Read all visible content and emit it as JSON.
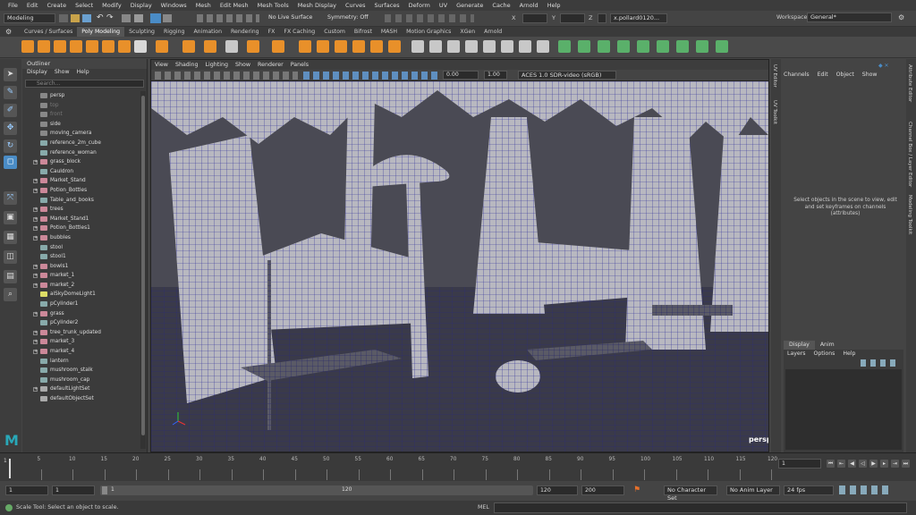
{
  "menus": [
    "File",
    "Edit",
    "Create",
    "Select",
    "Modify",
    "Display",
    "Windows",
    "Mesh",
    "Edit Mesh",
    "Mesh Tools",
    "Mesh Display",
    "Curves",
    "Surfaces",
    "Deform",
    "UV",
    "Generate",
    "Cache",
    "Arnold",
    "Help"
  ],
  "workspace": {
    "label": "Workspace:",
    "value": "General*"
  },
  "status": {
    "mode": "Modeling",
    "live_surface": "No Live Surface",
    "symmetry": "Symmetry: Off",
    "x_label": "X",
    "y_label": "Y",
    "z_label": "Z",
    "user": "x.pollard0120..."
  },
  "shelf_tabs": [
    "Curves / Surfaces",
    "Poly Modeling",
    "Sculpting",
    "Rigging",
    "Animation",
    "Rendering",
    "FX",
    "FX Caching",
    "Custom",
    "Bifrost",
    "MASH",
    "Motion Graphics",
    "XGen",
    "Arnold"
  ],
  "shelf_active": "Poly Modeling",
  "outliner": {
    "title": "Outliner",
    "menu": [
      "Display",
      "Show",
      "Help"
    ],
    "search_placeholder": "Search...",
    "items": [
      {
        "label": "persp",
        "type": "cam",
        "dim": false,
        "exp": false
      },
      {
        "label": "top",
        "type": "cam",
        "dim": true,
        "exp": false
      },
      {
        "label": "front",
        "type": "cam",
        "dim": true,
        "exp": false
      },
      {
        "label": "side",
        "type": "cam",
        "dim": false,
        "exp": false
      },
      {
        "label": "moving_camera",
        "type": "cam",
        "dim": false,
        "exp": false
      },
      {
        "label": "reference_2m_cube",
        "type": "mesh",
        "dim": false,
        "exp": false
      },
      {
        "label": "reference_woman",
        "type": "mesh",
        "dim": false,
        "exp": false
      },
      {
        "label": "grass_block",
        "type": "group",
        "dim": false,
        "exp": true
      },
      {
        "label": "Cauldron",
        "type": "mesh",
        "dim": false,
        "exp": false
      },
      {
        "label": "Market_Stand",
        "type": "group",
        "dim": false,
        "exp": true
      },
      {
        "label": "Potion_Bottles",
        "type": "group",
        "dim": false,
        "exp": true
      },
      {
        "label": "Table_and_books",
        "type": "mesh",
        "dim": false,
        "exp": false
      },
      {
        "label": "trees",
        "type": "group",
        "dim": false,
        "exp": true
      },
      {
        "label": "Market_Stand1",
        "type": "group",
        "dim": false,
        "exp": true
      },
      {
        "label": "Potion_Bottles1",
        "type": "group",
        "dim": false,
        "exp": true
      },
      {
        "label": "bubbles",
        "type": "group",
        "dim": false,
        "exp": true
      },
      {
        "label": "stool",
        "type": "mesh",
        "dim": false,
        "exp": false
      },
      {
        "label": "stool1",
        "type": "mesh",
        "dim": false,
        "exp": false
      },
      {
        "label": "bowls1",
        "type": "group",
        "dim": false,
        "exp": true
      },
      {
        "label": "market_1",
        "type": "group",
        "dim": false,
        "exp": true
      },
      {
        "label": "market_2",
        "type": "group",
        "dim": false,
        "exp": true
      },
      {
        "label": "aiSkyDomeLight1",
        "type": "light",
        "dim": false,
        "exp": false
      },
      {
        "label": "pCylinder1",
        "type": "mesh",
        "dim": false,
        "exp": false
      },
      {
        "label": "grass",
        "type": "group",
        "dim": false,
        "exp": true
      },
      {
        "label": "pCylinder2",
        "type": "mesh",
        "dim": false,
        "exp": false
      },
      {
        "label": "tree_trunk_updated",
        "type": "group",
        "dim": false,
        "exp": true
      },
      {
        "label": "market_3",
        "type": "group",
        "dim": false,
        "exp": true
      },
      {
        "label": "market_4",
        "type": "group",
        "dim": false,
        "exp": true
      },
      {
        "label": "lantern",
        "type": "mesh",
        "dim": false,
        "exp": false
      },
      {
        "label": "mushroom_stalk",
        "type": "mesh",
        "dim": false,
        "exp": false
      },
      {
        "label": "mushroom_cap",
        "type": "mesh",
        "dim": false,
        "exp": false
      },
      {
        "label": "defaultLightSet",
        "type": "set",
        "dim": false,
        "exp": true
      },
      {
        "label": "defaultObjectSet",
        "type": "set",
        "dim": false,
        "exp": false
      }
    ]
  },
  "viewport": {
    "menu": [
      "View",
      "Shading",
      "Lighting",
      "Show",
      "Renderer",
      "Panels"
    ],
    "exposure": "0.00",
    "gamma": "1.00",
    "colorspace": "ACES 1.0 SDR-video (sRGB)",
    "camera_label": "persp"
  },
  "channel_box": {
    "menu": [
      "Channels",
      "Edit",
      "Object",
      "Show"
    ],
    "message": "Select objects in the scene to view, edit and set keyframes on channels (attributes)",
    "side_tabs_left": [
      "UV Editor",
      "UV Toolkit"
    ],
    "side_tabs_right": [
      "Attribute Editor",
      "Channel Box / Layer Editor",
      "Modeling Toolkit"
    ]
  },
  "layers": {
    "tabs": [
      "Display",
      "Anim"
    ],
    "menu": [
      "Layers",
      "Options",
      "Help"
    ]
  },
  "timeline": {
    "ticks": [
      "5",
      "10",
      "15",
      "20",
      "25",
      "30",
      "35",
      "40",
      "45",
      "50",
      "55",
      "60",
      "65",
      "70",
      "75",
      "80",
      "85",
      "90",
      "95",
      "100",
      "105",
      "110",
      "115",
      "120"
    ],
    "start_tick": "1",
    "current_frame": "1"
  },
  "range": {
    "start": "1",
    "inner_start": "1",
    "slider_start": "1",
    "slider_end": "120",
    "inner_end": "120",
    "end": "200",
    "character_set": "No Character Set",
    "anim_layer": "No Anim Layer",
    "fps": "24 fps"
  },
  "command": {
    "mel": "MEL",
    "help": "Scale Tool: Select an object to scale."
  },
  "colors": {
    "accent": "#4a8cc6",
    "wire": "#2a2a9a",
    "mesh": "#b8b8c0",
    "bg": "#2f2f3a"
  }
}
